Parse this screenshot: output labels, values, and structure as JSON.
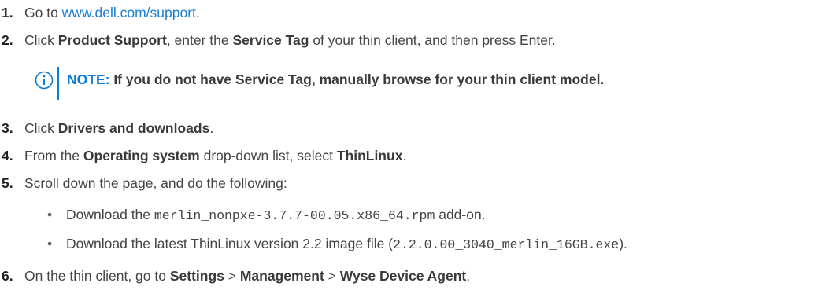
{
  "steps": [
    {
      "num": "1.",
      "pre": "Go to ",
      "link": "www.dell.com/support",
      "post": "."
    },
    {
      "num": "2.",
      "t1": "Click ",
      "b1": "Product Support",
      "t2": ", enter the ",
      "b2": "Service Tag",
      "t3": " of your thin client, and then press Enter."
    },
    {
      "num": "3.",
      "t1": "Click ",
      "b1": "Drivers and downloads",
      "t2": "."
    },
    {
      "num": "4.",
      "t1": "From the ",
      "b1": "Operating system",
      "t2": " drop-down list, select ",
      "b2": "ThinLinux",
      "t3": "."
    },
    {
      "num": "5.",
      "t1": "Scroll down the page, and do the following:"
    },
    {
      "num": "6.",
      "t1": "On the thin client, go to ",
      "b1": "Settings",
      "t2": " > ",
      "b2": "Management",
      "t3": " > ",
      "b3": "Wyse Device Agent",
      "t4": "."
    }
  ],
  "note": {
    "label": "NOTE:",
    "text": " If you do not have Service Tag, manually browse for your thin client model."
  },
  "bullets": [
    {
      "dot": "•",
      "t1": "Download the ",
      "code": "merlin_nonpxe-3.7.7-00.05.x86_64.rpm",
      "t2": " add-on."
    },
    {
      "dot": "•",
      "t1": "Download the latest ThinLinux version 2.2 image file (",
      "code": "2.2.0.00_3040_merlin_16GB.exe",
      "t2": ")."
    }
  ],
  "colors": {
    "link": "#1a7fd4",
    "note_accent": "#0b7bd6",
    "text": "#444444"
  },
  "icons": {
    "note": "info-circle-icon"
  }
}
